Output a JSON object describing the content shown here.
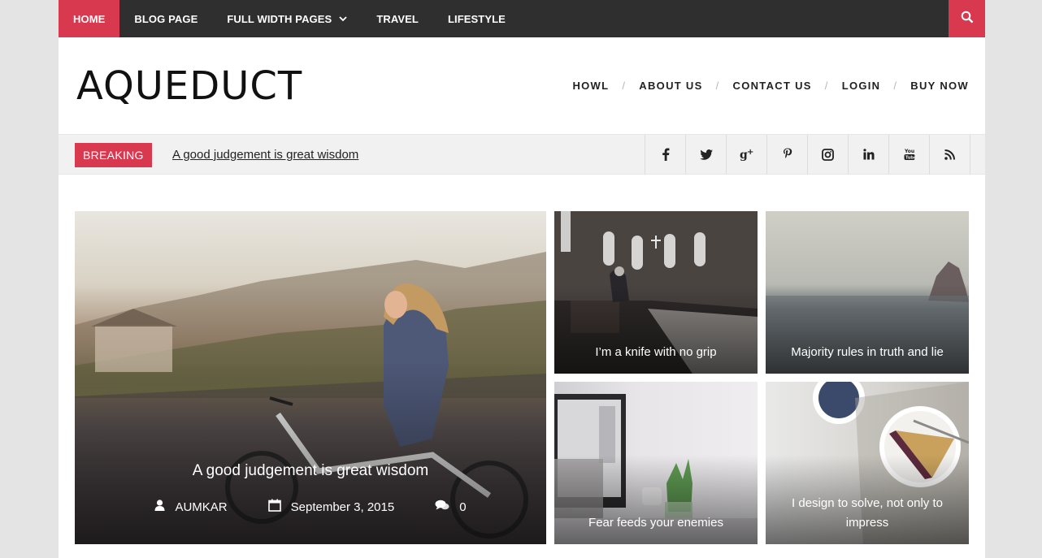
{
  "topnav": {
    "items": [
      {
        "label": "HOME",
        "active": true
      },
      {
        "label": "BLOG PAGE",
        "active": false
      },
      {
        "label": "FULL WIDTH PAGES",
        "active": false,
        "has_dropdown": true
      },
      {
        "label": "TRAVEL",
        "active": false
      },
      {
        "label": "LIFESTYLE",
        "active": false
      }
    ],
    "search_icon": "search-icon"
  },
  "header": {
    "logo": "AQUEDUCT",
    "secondary_nav": [
      "HOWL",
      "ABOUT US",
      "CONTACT US",
      "LOGIN",
      "BUY NOW"
    ],
    "separator": "/"
  },
  "breaking": {
    "label": "BREAKING",
    "headline": "A good judgement is great wisdom"
  },
  "social": [
    "facebook-icon",
    "twitter-icon",
    "google-plus-icon",
    "pinterest-icon",
    "instagram-icon",
    "linkedin-icon",
    "youtube-icon",
    "rss-icon"
  ],
  "featured": {
    "title": "A good judgement is great wisdom",
    "author": "AUMKAR",
    "date": "September 3, 2015",
    "comments": "0"
  },
  "tiles": [
    {
      "title": "I’m a knife with no grip"
    },
    {
      "title": "Majority rules in truth and lie"
    },
    {
      "title": "Fear feeds your enemies"
    },
    {
      "title": "I design to solve, not only to impress"
    }
  ],
  "colors": {
    "accent": "#d9394f",
    "nav_bg": "#2f2f2f",
    "page_bg": "#e4e4e4"
  }
}
